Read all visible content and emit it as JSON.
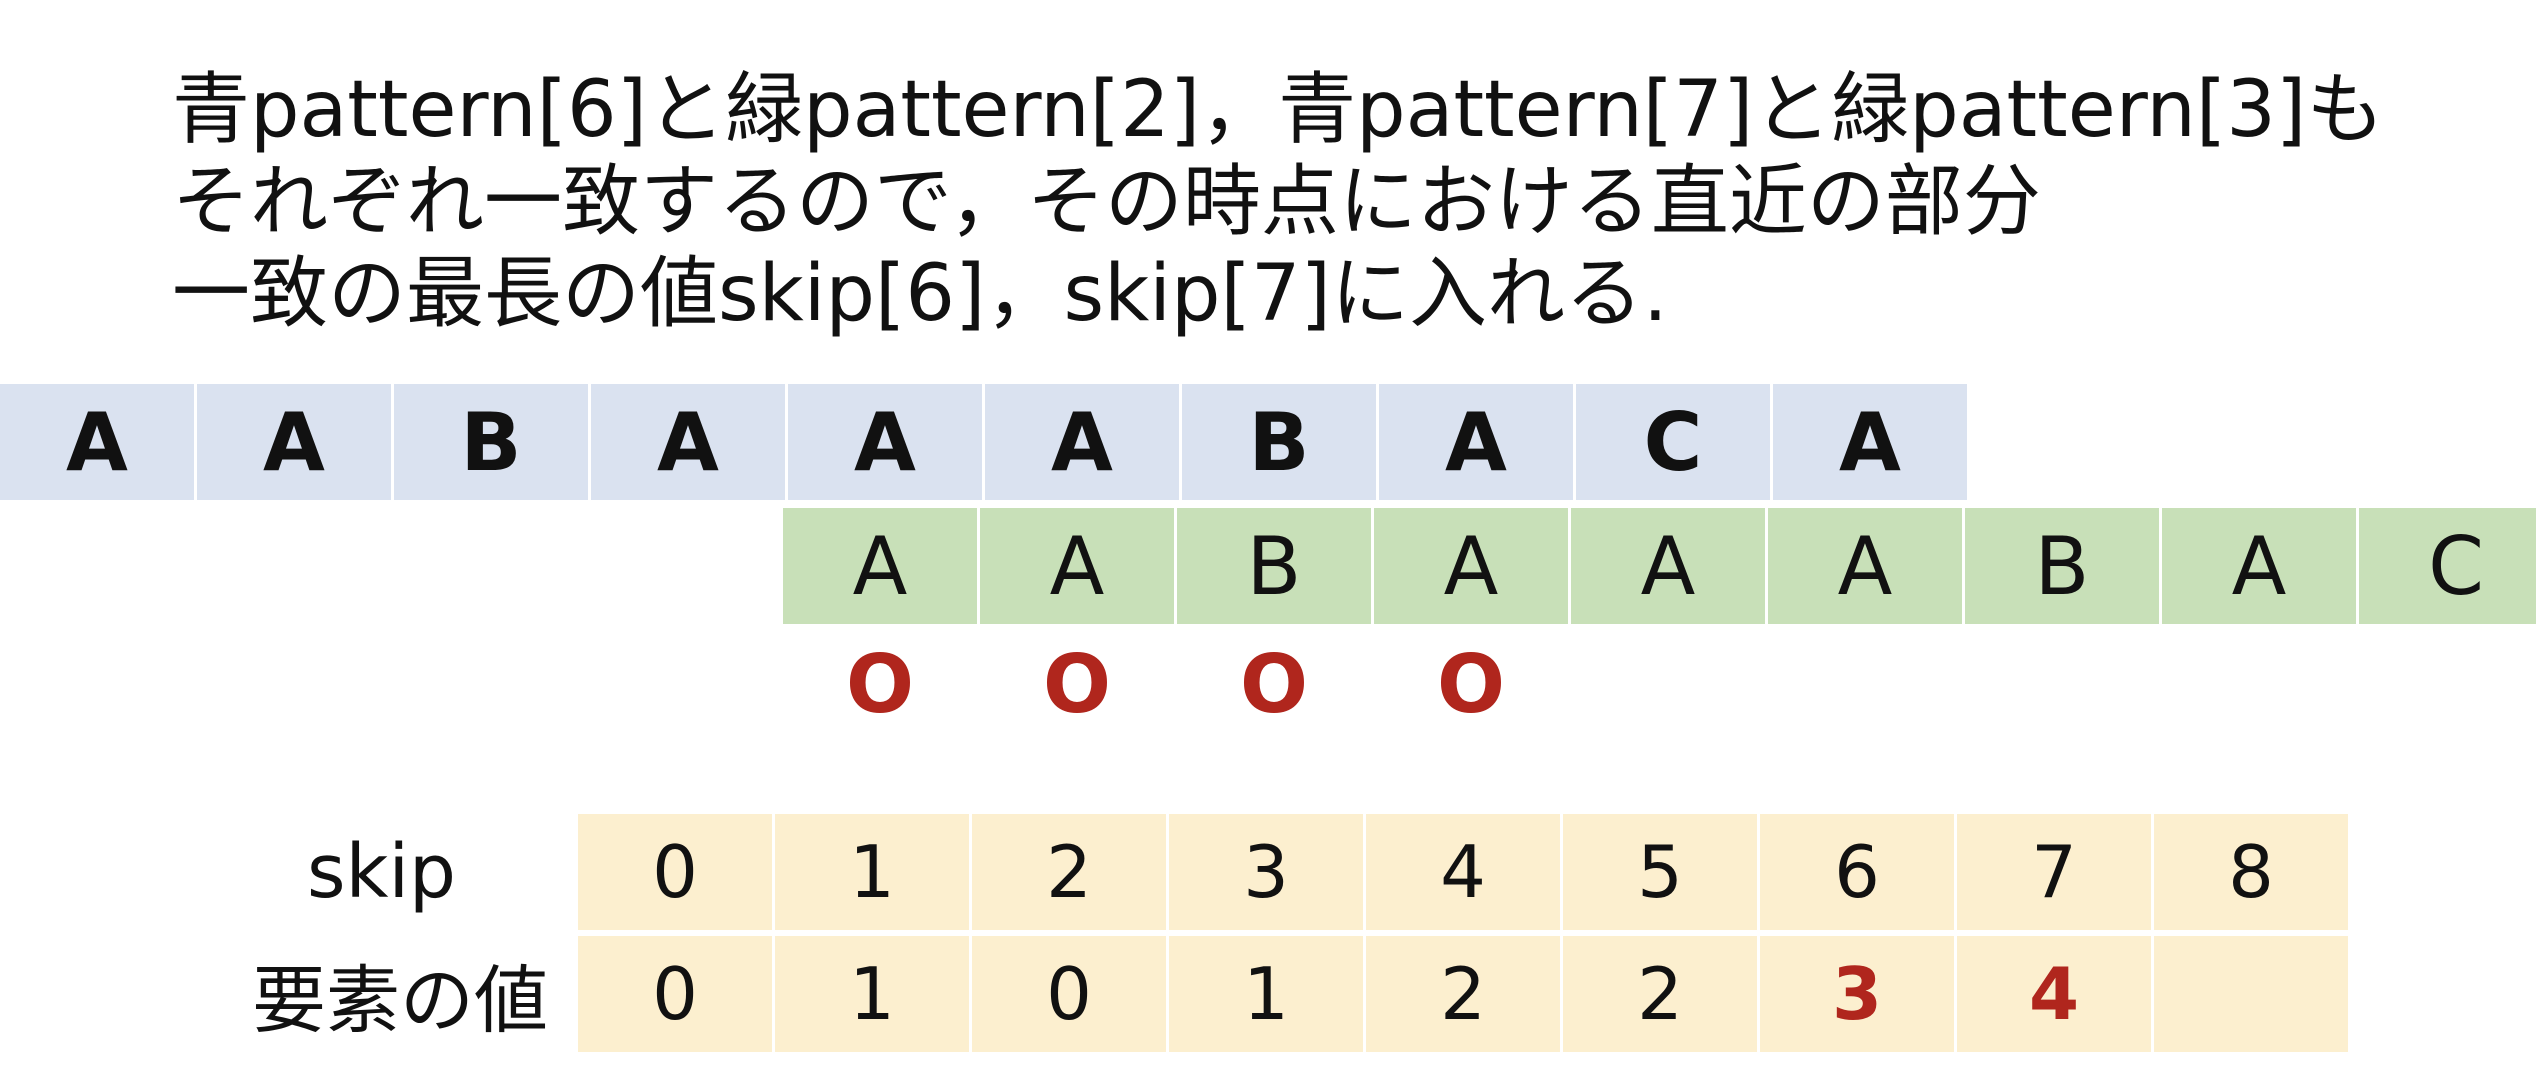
{
  "title": {
    "line1": "青pattern[6]と緑pattern[2]，青pattern[7]と緑pattern[3]も",
    "line2": "それぞれ一致するので，その時点における直近の部分",
    "line3": "一致の最長の値skip[6]，skip[7]に入れる."
  },
  "text_row": [
    "A",
    "A",
    "B",
    "A",
    "A",
    "A",
    "B",
    "A",
    "C",
    "A"
  ],
  "pattern_row": [
    "A",
    "A",
    "B",
    "A",
    "A",
    "A",
    "B",
    "A",
    "C"
  ],
  "match_row": [
    "O",
    "O",
    "O",
    "O"
  ],
  "skip_label": "skip",
  "value_label": "要素の値",
  "skip_indices": [
    "0",
    "1",
    "2",
    "3",
    "4",
    "5",
    "6",
    "7",
    "8"
  ],
  "skip_values": [
    "0",
    "1",
    "0",
    "1",
    "2",
    "2",
    "3",
    "4",
    ""
  ],
  "highlighted_value_indices": [
    6,
    7
  ],
  "colors": {
    "text_row_bg": "#dae2f0",
    "pattern_row_bg": "#c8e0b8",
    "skip_table_bg": "#fcefcf",
    "highlight_red": "#b0261d"
  }
}
